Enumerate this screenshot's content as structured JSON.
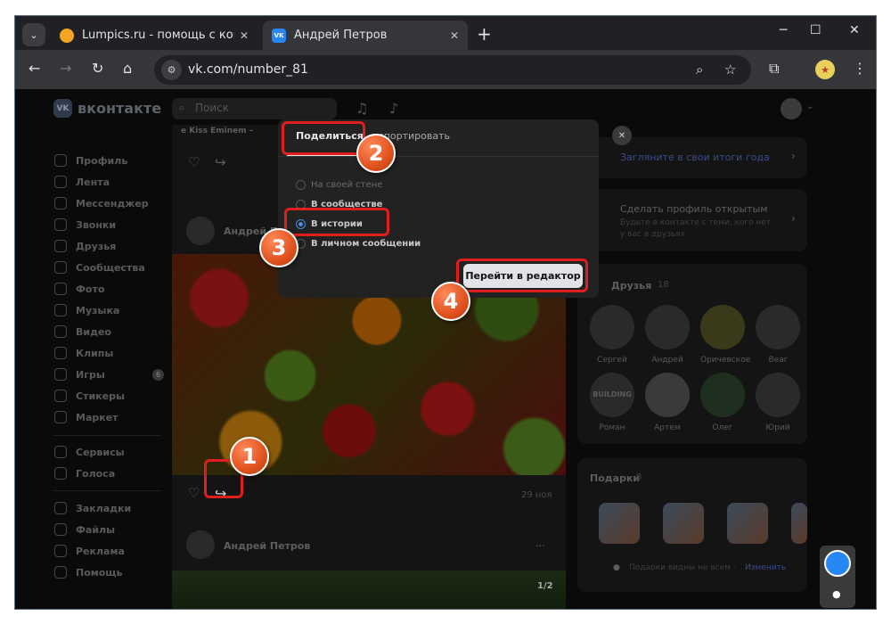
{
  "browser": {
    "tabs": [
      {
        "title": "Lumpics.ru - помощь с компьютером",
        "icon": "orange-circle-icon"
      },
      {
        "title": "Андрей Петров",
        "icon": "vk-logo-icon"
      }
    ],
    "new_tab": "+",
    "url": "vk.com/number_81"
  },
  "vk": {
    "brand": "вконтакте",
    "logo": "VK",
    "search_placeholder": "Поиск",
    "sidebar": [
      {
        "label": "Профиль"
      },
      {
        "label": "Лента"
      },
      {
        "label": "Мессенджер"
      },
      {
        "label": "Звонки"
      },
      {
        "label": "Друзья"
      },
      {
        "label": "Сообщества"
      },
      {
        "label": "Фото"
      },
      {
        "label": "Музыка"
      },
      {
        "label": "Видео"
      },
      {
        "label": "Клипы"
      },
      {
        "label": "Игры",
        "badge": "6"
      },
      {
        "label": "Стикеры"
      },
      {
        "label": "Маркет"
      },
      {
        "label": "Сервисы"
      },
      {
        "label": "Голоса"
      },
      {
        "label": "Закладки"
      },
      {
        "label": "Файлы"
      },
      {
        "label": "Реклама"
      },
      {
        "label": "Помощь"
      }
    ],
    "feed": {
      "top_snippet": "e Kiss  Eminem –",
      "author": "Андрей Петров",
      "date": "29 ноя",
      "author_2": "Андрей Петров",
      "counter": "1/2"
    },
    "right": {
      "summary_link": "Загляните в свои итоги года",
      "open_profile_title": "Сделать профиль открытым",
      "open_profile_desc": "Будьте в контакте с теми, кого нет у вас в друзьях",
      "friends_title": "Друзья",
      "friends_count": "18",
      "friends": [
        "Сергей",
        "Андрей",
        "Оричевское",
        "Bear",
        "Роман",
        "Артем",
        "Олег",
        "Юрий"
      ],
      "building_text": "BUILDING",
      "gifts_title": "Подарки",
      "gifts_count": "8",
      "gifts_note": "Подарки видны не всем · ",
      "gifts_change": "Изменить"
    }
  },
  "modal": {
    "tab_share": "Поделиться",
    "tab_export": "Экспортировать",
    "tab_export_visible": "кспортировать",
    "options": [
      {
        "label": "На своей стене",
        "selected": false
      },
      {
        "label": "В сообществе",
        "selected": false
      },
      {
        "label": "В истории",
        "selected": true
      },
      {
        "label": "В личном сообщении",
        "selected": false
      }
    ],
    "editor_button": "Перейти в редактор"
  },
  "annotations": {
    "step1": "1",
    "step2": "2",
    "step3": "3",
    "step4": "4",
    "color": "#e01e1e"
  }
}
